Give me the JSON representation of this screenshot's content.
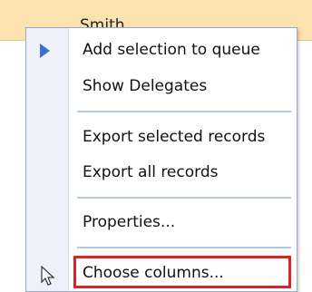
{
  "background": {
    "row_text": "Smith"
  },
  "menu": {
    "items": [
      {
        "label": "Add selection to queue"
      },
      {
        "label": "Show Delegates"
      },
      {
        "label": "Export selected records"
      },
      {
        "label": "Export all records"
      },
      {
        "label": "Properties..."
      },
      {
        "label": "Choose columns..."
      }
    ],
    "icons": {
      "submenu": "play-arrow-icon",
      "pointer": "mouse-pointer-icon"
    },
    "colors": {
      "highlight": "#d8232a",
      "arrow": "#3c6fd0",
      "row_highlight": "#fbe3b0"
    }
  }
}
